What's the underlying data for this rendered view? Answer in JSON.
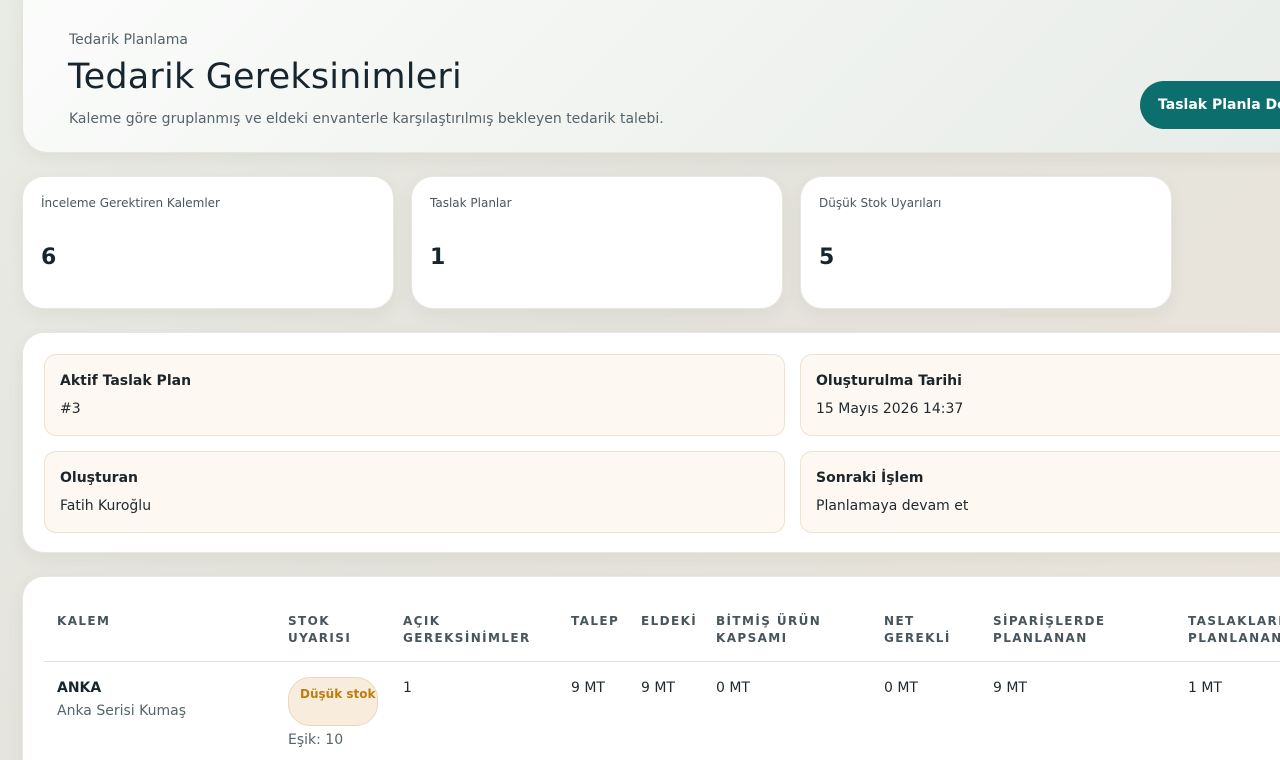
{
  "header": {
    "eyebrow": "Tedarik Planlama",
    "title": "Tedarik Gereksinimleri",
    "subtitle": "Kaleme göre gruplanmış ve eldeki envanterle karşılaştırılmış bekleyen tedarik talebi.",
    "action_label": "Taslak Planla Devam Et"
  },
  "stats": [
    {
      "label": "İnceleme Gerektiren Kalemler",
      "value": "6"
    },
    {
      "label": "Taslak Planlar",
      "value": "1"
    },
    {
      "label": "Düşük Stok Uyarıları",
      "value": "5"
    }
  ],
  "plan": {
    "active_plan": {
      "title": "Aktif Taslak Plan",
      "value": "#3"
    },
    "created_at": {
      "title": "Oluşturulma Tarihi",
      "value": "15 Mayıs 2026 14:37"
    },
    "created_by": {
      "title": "Oluşturan",
      "value": "Fatih Kuroğlu"
    },
    "next_step": {
      "title": "Sonraki İşlem",
      "value": "Planlamaya devam et"
    }
  },
  "table": {
    "columns": {
      "item": "KALEM",
      "stock_alert": "STOK UYARISI",
      "open_requirements": "AÇIK GEREKSİNİMLER",
      "demand": "TALEP",
      "on_hand": "ELDEKİ",
      "finished_coverage": "BİTMİŞ ÜRÜN KAPSAMI",
      "net_required": "NET GEREKLİ",
      "planned_in_orders": "SİPARİŞLERDE PLANLANAN",
      "planned_in_drafts": "TASLAKLARDA PLANLANAN"
    },
    "rows": [
      {
        "code": "ANKA",
        "name": "Anka Serisi Kumaş",
        "badge": "Düşük stok",
        "threshold": "Eşik: 10",
        "open_requirements": "1",
        "demand": "9 MT",
        "on_hand": "9 MT",
        "finished_coverage": "0 MT",
        "net_required": "0 MT",
        "planned_in_orders": "9 MT",
        "planned_in_drafts": "1 MT"
      }
    ]
  },
  "colors": {
    "accent": "#0d6e6e",
    "badge_text": "#c07d0f",
    "badge_bg": "#f8eddc",
    "info_box_bg": "#fdf8f1"
  }
}
